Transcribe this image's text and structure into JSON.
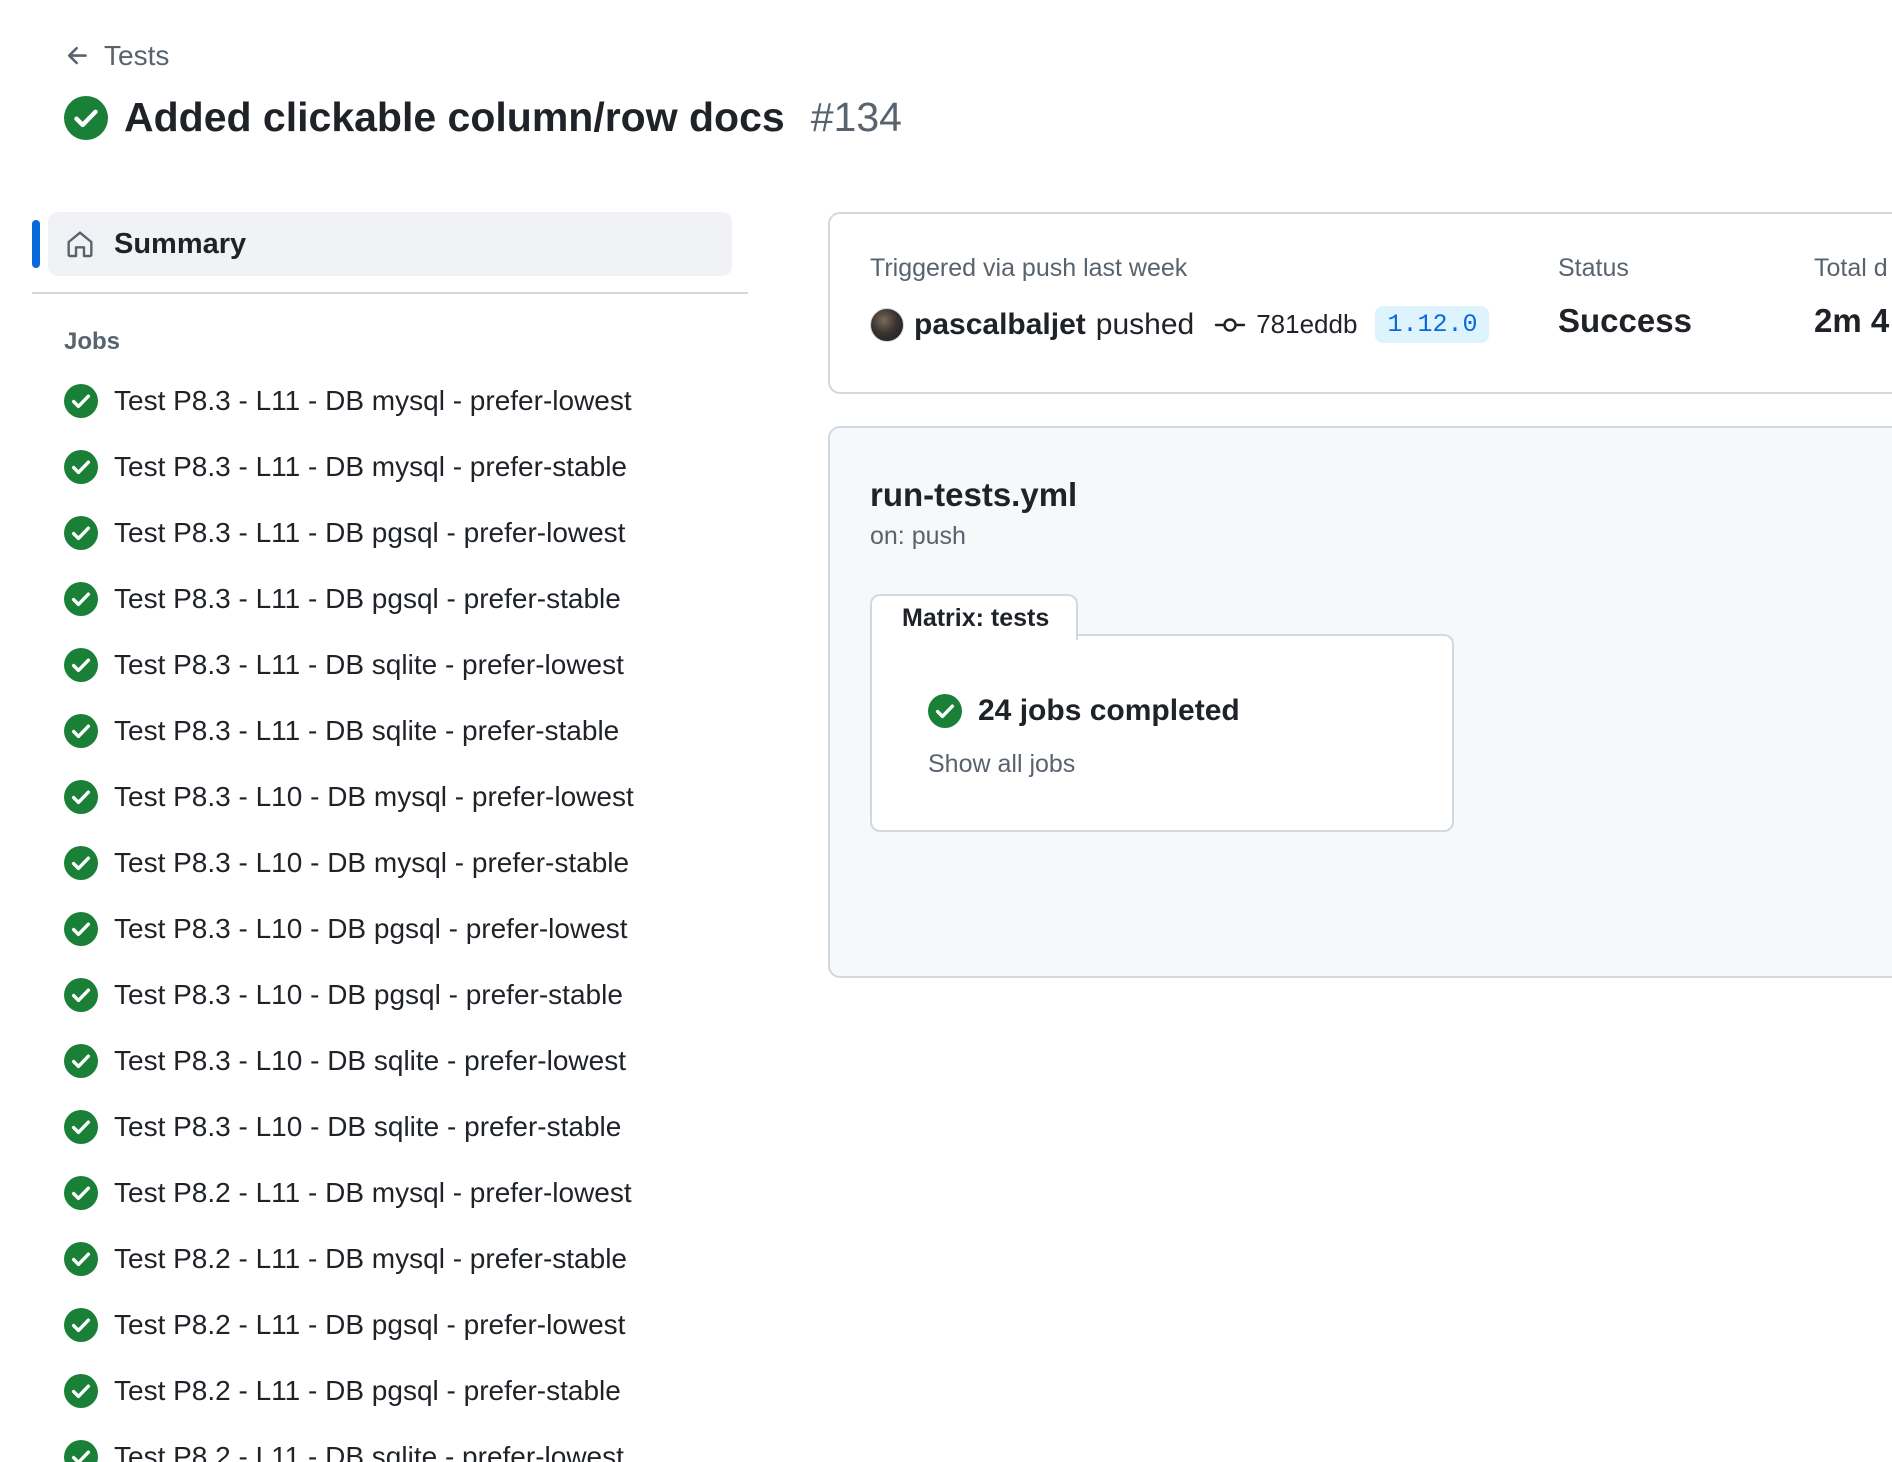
{
  "header": {
    "back_label": "Tests",
    "title": "Added clickable column/row docs",
    "run_number": "#134"
  },
  "sidebar": {
    "summary_label": "Summary",
    "jobs_heading": "Jobs",
    "jobs": [
      "Test P8.3 - L11 - DB mysql - prefer-lowest",
      "Test P8.3 - L11 - DB mysql - prefer-stable",
      "Test P8.3 - L11 - DB pgsql - prefer-lowest",
      "Test P8.3 - L11 - DB pgsql - prefer-stable",
      "Test P8.3 - L11 - DB sqlite - prefer-lowest",
      "Test P8.3 - L11 - DB sqlite - prefer-stable",
      "Test P8.3 - L10 - DB mysql - prefer-lowest",
      "Test P8.3 - L10 - DB mysql - prefer-stable",
      "Test P8.3 - L10 - DB pgsql - prefer-lowest",
      "Test P8.3 - L10 - DB pgsql - prefer-stable",
      "Test P8.3 - L10 - DB sqlite - prefer-lowest",
      "Test P8.3 - L10 - DB sqlite - prefer-stable",
      "Test P8.2 - L11 - DB mysql - prefer-lowest",
      "Test P8.2 - L11 - DB mysql - prefer-stable",
      "Test P8.2 - L11 - DB pgsql - prefer-lowest",
      "Test P8.2 - L11 - DB pgsql - prefer-stable",
      "Test P8.2 - L11 - DB sqlite - prefer-lowest"
    ]
  },
  "info": {
    "trigger_label": "Triggered via push last week",
    "actor": "pascalbaljet",
    "action": "pushed",
    "commit_sha": "781eddb",
    "tag": "1.12.0",
    "status_label": "Status",
    "status_value": "Success",
    "duration_label": "Total d",
    "duration_value": "2m 4"
  },
  "workflow": {
    "file": "run-tests.yml",
    "on": "on: push",
    "matrix_label": "Matrix: tests",
    "completed": "24 jobs completed",
    "show_all": "Show all jobs"
  },
  "colors": {
    "success": "#1a7f37",
    "accent": "#0969da",
    "tag_bg": "#ddf4ff"
  }
}
